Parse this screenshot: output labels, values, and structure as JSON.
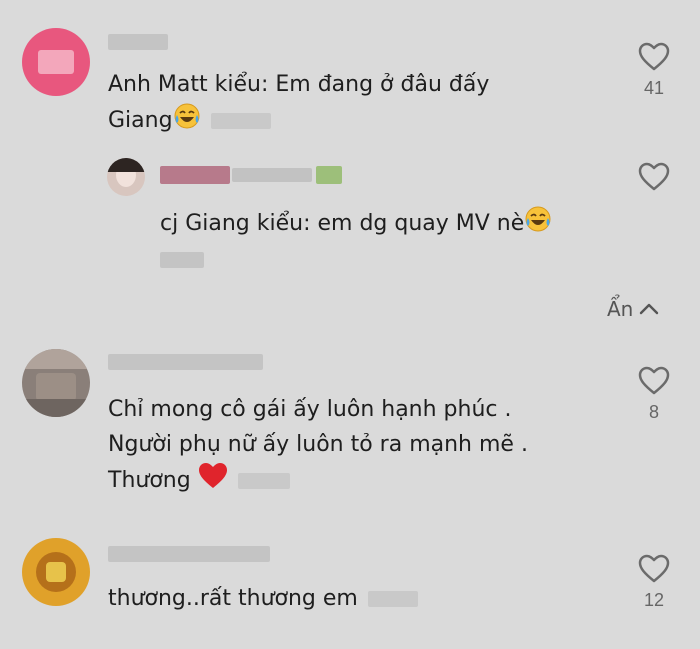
{
  "comments": [
    {
      "text_lines": [
        "Anh Matt kiểu: Em đang ở đâu đấy",
        "Giang"
      ],
      "likes": "41",
      "colors": {
        "avatar": "#e8577e"
      }
    },
    {
      "text_lines": [
        "cj Giang kiểu: em dg quay MV nè"
      ],
      "likes": "",
      "colors": {
        "avatar": "#d8c6bf"
      }
    },
    {
      "text_lines": [
        "Chỉ mong cô gái ấy luôn hạnh phúc .",
        "Người phụ nữ ấy luôn tỏ ra mạnh mẽ .",
        "Thương"
      ],
      "likes": "8",
      "colors": {
        "avatar": "#8a7f79"
      }
    },
    {
      "text_lines": [
        "thương..rất thương em"
      ],
      "likes": "12",
      "colors": {
        "avatar": "#e0a12a"
      }
    }
  ],
  "replies_toggle": {
    "label": "Ẩn"
  },
  "icons": {
    "like": "heart-outline-icon",
    "collapse": "chevron-up-icon",
    "laugh": "face-with-tears-of-joy-icon",
    "heart": "red-heart-icon"
  }
}
